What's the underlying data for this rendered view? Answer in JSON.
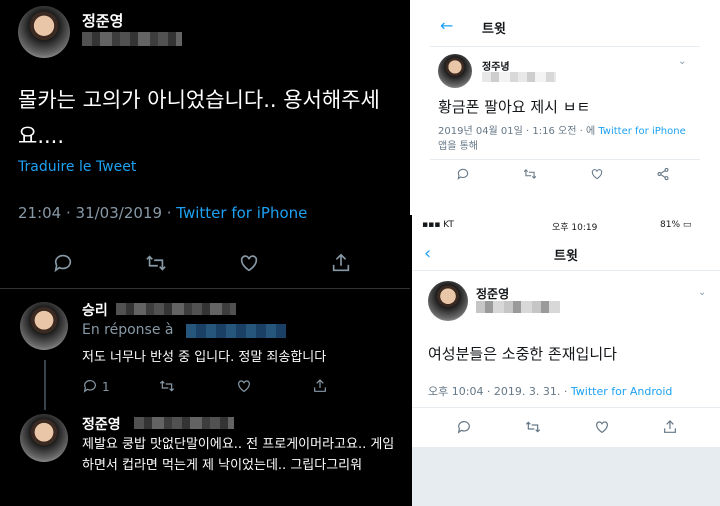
{
  "left": {
    "main_tweet": {
      "author": "정준영",
      "text": "몰카는 고의가 아니었습니다.. 용서해주세요....",
      "translate_link": "Traduire le Tweet",
      "timestamp": "21:04 · 31/03/2019 · ",
      "source": "Twitter for iPhone"
    },
    "reply1": {
      "author": "승리",
      "replying_to": "En réponse à",
      "text": "저도 너무나 반성 중 입니다. 정말 죄송합니다",
      "reply_count": "1"
    },
    "reply2": {
      "author": "정준영",
      "text": "제발요 쿵밥 맛없단말이에요.. 전 프로게이머라고요.. 게임하면서 컵라면 먹는게 제 낙이었는데.. 그립다그리워"
    }
  },
  "right_top": {
    "back_icon": "←",
    "header_title": "트윗",
    "author": "정주녕",
    "tweet_text": "황금폰 팔아요 제시 ㅂㅌ",
    "timestamp": "2019년 04월 01일 · 1:16 오전 · 에 ",
    "source": "Twitter for iPhone",
    "source_suffix": " 앱을 통해"
  },
  "right_bottom": {
    "status_bar": {
      "carrier": "KT",
      "time": "오후 10:19",
      "battery": "81%"
    },
    "back_icon": "‹",
    "header_title": "트윗",
    "author": "정준영",
    "tweet_text": "여성분들은 소중한 존재입니다",
    "timestamp": "오후 10:04 · 2019. 3. 31. · ",
    "source": "Twitter for Android"
  },
  "icon_names": [
    "reply-icon",
    "retweet-icon",
    "like-icon",
    "share-icon"
  ],
  "colors": {
    "link_blue": "#1da1f2",
    "dark_bg": "#000000",
    "muted_gray": "#8899a6"
  }
}
